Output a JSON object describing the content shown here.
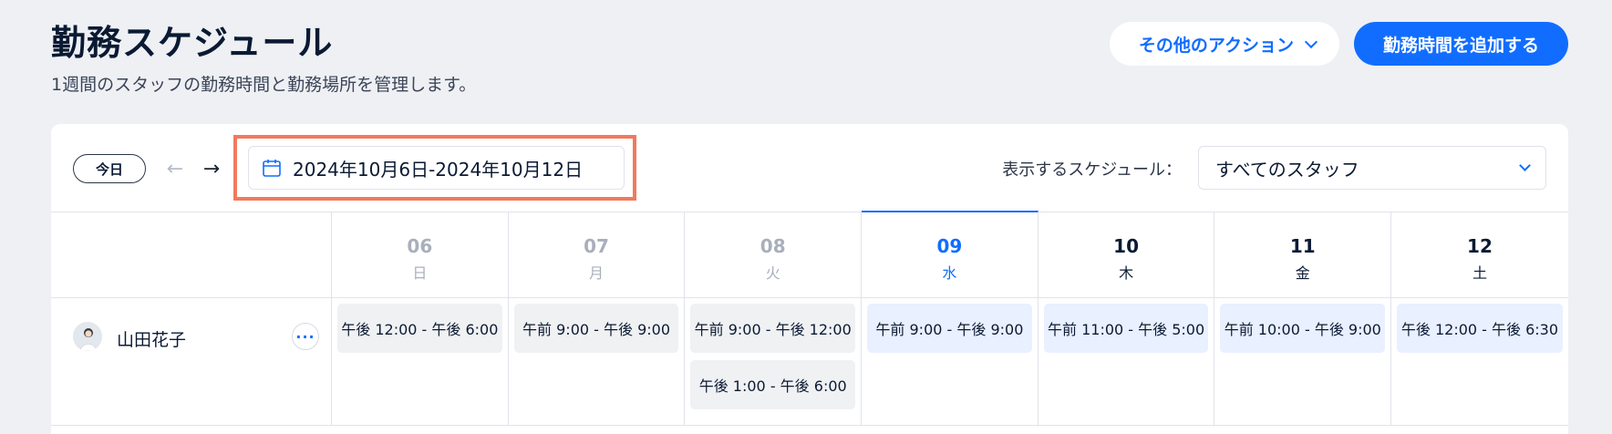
{
  "header": {
    "title": "勤務スケジュール",
    "subtitle": "1週間のスタッフの勤務時間と勤務場所を管理します。"
  },
  "actions": {
    "more_actions_label": "その他のアクション",
    "add_hours_label": "勤務時間を追加する"
  },
  "toolbar": {
    "today_label": "今日",
    "prev_icon": "←",
    "next_icon": "→",
    "date_range": "2024年10月6日-2024年10月12日",
    "schedule_label": "表示するスケジュール：",
    "staff_select_value": "すべてのスタッフ"
  },
  "days": [
    {
      "num": "06",
      "weekday": "日",
      "state": "past"
    },
    {
      "num": "07",
      "weekday": "月",
      "state": "past"
    },
    {
      "num": "08",
      "weekday": "火",
      "state": "past"
    },
    {
      "num": "09",
      "weekday": "水",
      "state": "current"
    },
    {
      "num": "10",
      "weekday": "木",
      "state": "future"
    },
    {
      "num": "11",
      "weekday": "金",
      "state": "future"
    },
    {
      "num": "12",
      "weekday": "土",
      "state": "future"
    }
  ],
  "staff": [
    {
      "name": "山田花子",
      "shifts": [
        [
          "午後 12:00 - 午後 6:00"
        ],
        [
          "午前 9:00 - 午後 9:00"
        ],
        [
          "午前 9:00 - 午後 12:00",
          "午後 1:00 - 午後 6:00"
        ],
        [
          "午前 9:00 - 午後 9:00"
        ],
        [
          "午前 11:00 - 午後 5:00"
        ],
        [
          "午前 10:00 - 午後 9:00"
        ],
        [
          "午後 12:00 - 午後 6:30"
        ]
      ]
    }
  ],
  "colors": {
    "accent": "#116dff",
    "highlight": "#f07a5c",
    "past_shift_bg": "#f0f1f3",
    "future_shift_bg": "#e9f0ff"
  }
}
